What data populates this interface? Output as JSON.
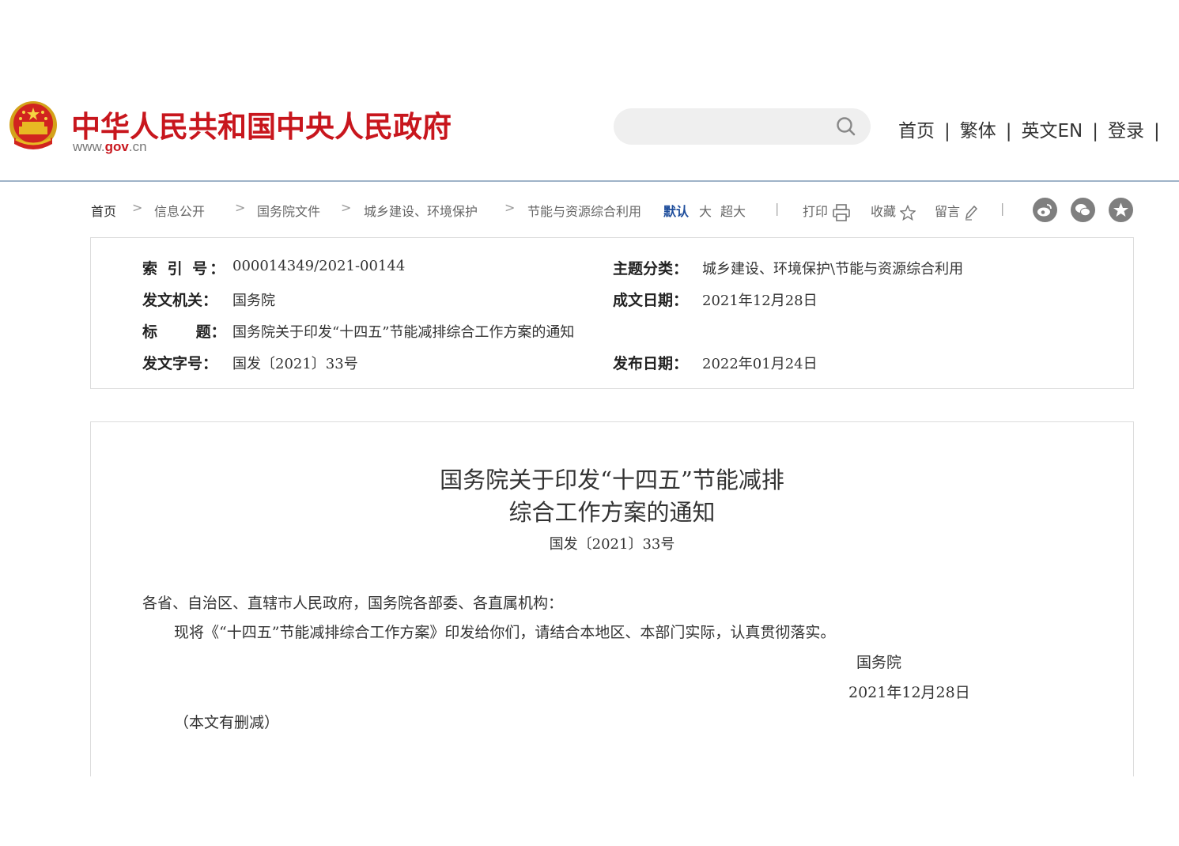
{
  "header": {
    "site_title": "中华人民共和国中央人民政府",
    "site_url_prefix": "www.",
    "site_url_domain": "gov",
    "site_url_suffix": ".cn",
    "search_placeholder": "",
    "nav": [
      "首页",
      "繁体",
      "英文EN",
      "登录"
    ],
    "nav_separator": "|",
    "brand_color": "#c8161d"
  },
  "breadcrumb": {
    "items": [
      "首页",
      "信息公开",
      "国务院文件",
      "城乡建设、环境保护",
      "节能与资源综合利用"
    ],
    "arrow": ">"
  },
  "font_size": {
    "options": [
      "默认",
      "大",
      "超大"
    ],
    "selected": "默认",
    "separator": "|"
  },
  "tools": {
    "print": "打印",
    "favorite": "收藏",
    "comment": "留言",
    "separator": "|"
  },
  "share": [
    "weibo-icon",
    "wechat-icon",
    "qzone-icon"
  ],
  "meta": {
    "index_label": "索 引 号：",
    "index_value": "000014349/2021-00144",
    "category_label": "主题分类：",
    "category_value": "城乡建设、环境保护\\节能与资源综合利用",
    "issuer_label": "发文机关：",
    "issuer_value": "国务院",
    "created_label": "成文日期：",
    "created_value": "2021年12月28日",
    "title_label": "标 题：",
    "title_value": "国务院关于印发“十四五”节能减排综合工作方案的通知",
    "docno_label": "发文字号：",
    "docno_value": "国发〔2021〕33号",
    "published_label": "发布日期：",
    "published_value": "2022年01月24日"
  },
  "document": {
    "title_line1": "国务院关于印发“十四五”节能减排",
    "title_line2": "综合工作方案的通知",
    "number": "国发〔2021〕33号",
    "salutation": "各省、自治区、直辖市人民政府，国务院各部委、各直属机构：",
    "body": "现将《“十四五”节能减排综合工作方案》印发给你们，请结合本地区、本部门实际，认真贯彻落实。",
    "signature": "国务院",
    "date": "2021年12月28日",
    "note": "（本文有删减）"
  }
}
